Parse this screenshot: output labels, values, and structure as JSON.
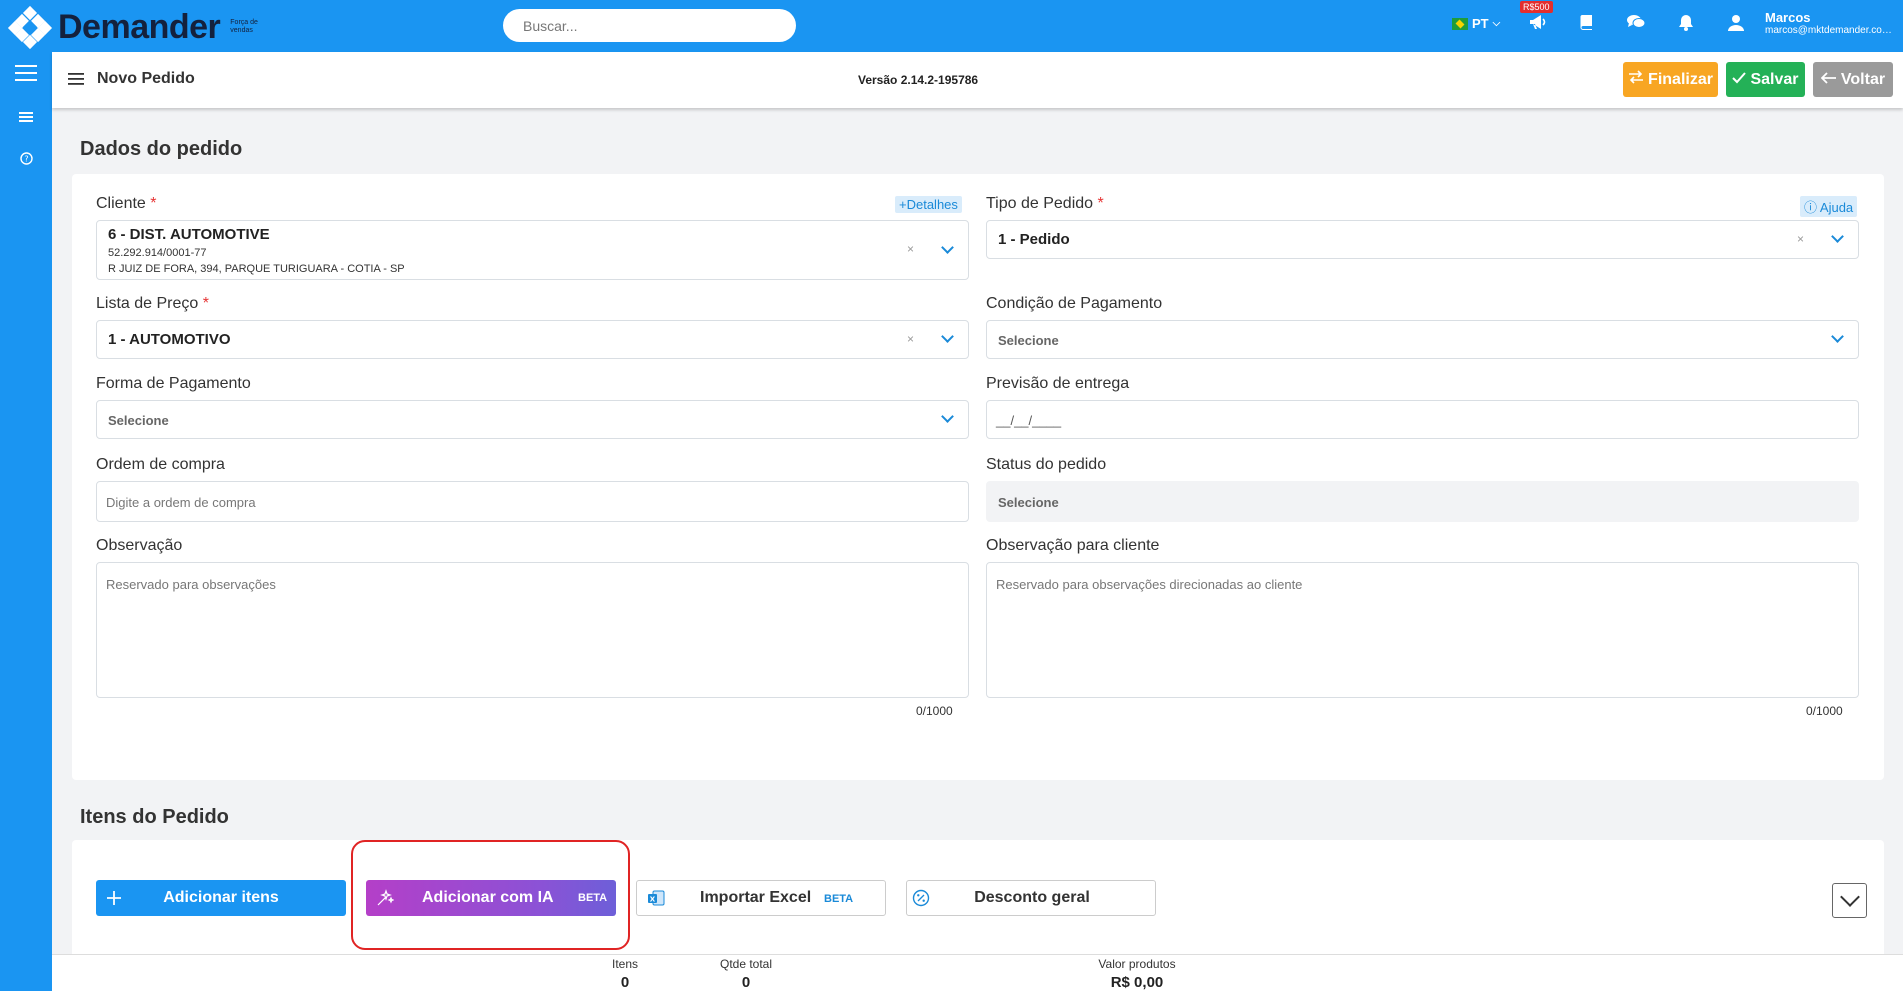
{
  "app": {
    "brand": "Demander",
    "brand_sub": "Força de vendas",
    "search_placeholder": "Buscar...",
    "lang": "PT",
    "notif_badge": "R$500",
    "user_name": "Marcos",
    "user_email": "marcos@mktdemander.com.br"
  },
  "header": {
    "title": "Novo Pedido",
    "version": "Versão 2.14.2-195786",
    "finalizar": "Finalizar",
    "salvar": "Salvar",
    "voltar": "Voltar"
  },
  "dados": {
    "section_title": "Dados do pedido",
    "detalhes": "Detalhes",
    "ajuda": "Ajuda",
    "required_mark": "*",
    "cliente": {
      "label": "Cliente",
      "name": "6 - DIST. AUTOMOTIVE",
      "cnpj": "52.292.914/0001-77",
      "address": "R JUIZ DE FORA, 394, PARQUE TURIGUARA - COTIA - SP"
    },
    "tipo_pedido": {
      "label": "Tipo de Pedido",
      "value": "1 - Pedido"
    },
    "lista_preco": {
      "label": "Lista de Preço",
      "value": "1 - AUTOMOTIVO"
    },
    "condicao_pagamento": {
      "label": "Condição de Pagamento",
      "placeholder": "Selecione"
    },
    "forma_pagamento": {
      "label": "Forma de Pagamento",
      "placeholder": "Selecione"
    },
    "previsao_entrega": {
      "label": "Previsão de entrega",
      "placeholder": "__/__/____"
    },
    "ordem_compra": {
      "label": "Ordem de compra",
      "placeholder": "Digite a ordem de compra"
    },
    "status_pedido": {
      "label": "Status do pedido",
      "placeholder": "Selecione"
    },
    "observacao": {
      "label": "Observação",
      "placeholder": "Reservado para observações",
      "counter": "0/1000"
    },
    "observacao_cliente": {
      "label": "Observação para cliente",
      "placeholder": "Reservado para observações direcionadas ao cliente",
      "counter": "0/1000"
    }
  },
  "itens": {
    "section_title": "Itens do Pedido",
    "add_itens": "Adicionar itens",
    "add_ia": "Adicionar com IA",
    "add_ia_tag": "BETA",
    "importar_excel": "Importar Excel",
    "importar_excel_tag": "BETA",
    "desconto_geral": "Desconto geral"
  },
  "footer": {
    "itens_label": "Itens",
    "itens_value": "0",
    "qtde_label": "Qtde total",
    "qtde_value": "0",
    "valor_label": "Valor produtos",
    "valor_value": "R$ 0,00"
  },
  "colors": {
    "primary": "#1a95f2",
    "finalizar": "#f8a623",
    "salvar": "#24b157",
    "voltar": "#9a9a9a",
    "ia_gradient_start": "#b43fc8",
    "ia_gradient_end": "#6d5fd8"
  },
  "icons": [
    "menu-icon",
    "list-icon",
    "help-icon",
    "megaphone-icon",
    "book-icon",
    "chat-icon",
    "bell-icon",
    "user-icon",
    "swap-icon",
    "check-icon",
    "arrow-left-icon",
    "plus-icon",
    "sparkle-icon",
    "excel-icon",
    "percent-icon",
    "chevron-down-icon"
  ]
}
